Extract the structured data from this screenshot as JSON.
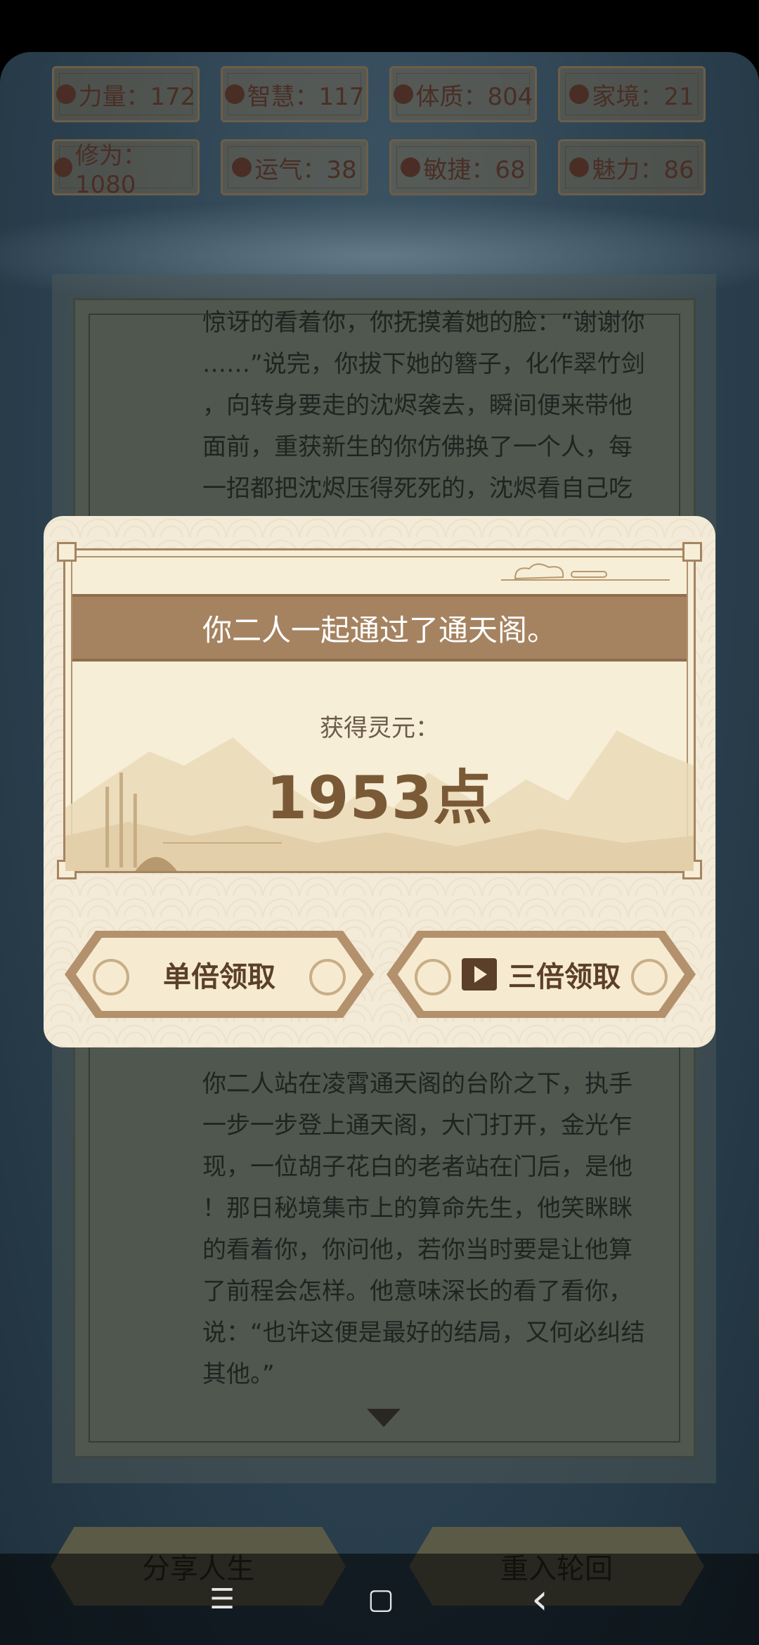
{
  "stats": [
    {
      "label": "力量：172",
      "icon": "strength-icon"
    },
    {
      "label": "智慧：117",
      "icon": "wisdom-icon"
    },
    {
      "label": "体质：804",
      "icon": "constitution-icon"
    },
    {
      "label": "家境：21",
      "icon": "family-icon"
    },
    {
      "label": "修为：1080",
      "icon": "cultivation-icon"
    },
    {
      "label": "运气：38",
      "icon": "luck-icon"
    },
    {
      "label": "敏捷：68",
      "icon": "agility-icon"
    },
    {
      "label": "魅力：86",
      "icon": "charm-icon"
    }
  ],
  "story_top": [
    "惊讶的看着你，你抚摸着她的脸：“谢谢你",
    "……”说完，你拔下她的簪子，化作翠竹剑",
    "，向转身要走的沈烬袭去，瞬间便来带他",
    "面前，重获新生的你仿佛换了一个人，每",
    "一招都把沈烬压得死死的，沈烬看自己吃"
  ],
  "story_bottom": [
    "你二人站在凌霄通天阁的台阶之下，执手",
    "一步一步登上通天阁，大门打开，金光乍",
    "现，一位胡子花白的老者站在门后，是他",
    "！那日秘境集市上的算命先生，他笑眯眯",
    "的看着你，你问他，若你当时要是让他算",
    "了前程会怎样。他意味深长的看了看你，",
    "说：“也许这便是最好的结局，又何必纠结",
    "其他。”"
  ],
  "dialog": {
    "title": "你二人一起通过了通天阁。",
    "reward_label": "获得灵元：",
    "reward_value": "1953点",
    "single_button": "单倍领取",
    "triple_button": "三倍领取"
  },
  "bottom_buttons": {
    "share": "分享人生",
    "restart": "重入轮回"
  },
  "nav": {
    "menu": "☰",
    "home": "▢",
    "back": "‹"
  }
}
